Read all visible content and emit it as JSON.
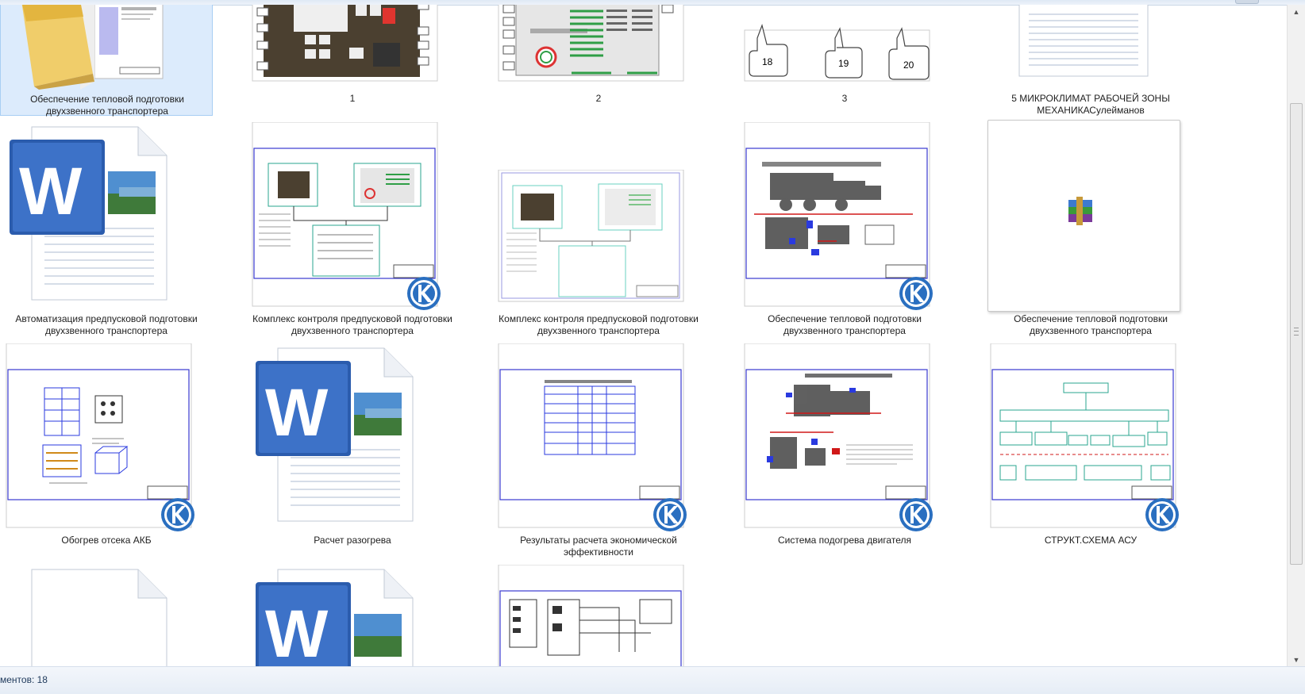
{
  "items": [
    {
      "label": "Обеспечение тепловой  подготовки двухзвенного транспортера",
      "icon": "folder-icon"
    },
    {
      "label": "1",
      "icon": "kompas-drawing-icon"
    },
    {
      "label": "2",
      "icon": "kompas-drawing-icon"
    },
    {
      "label": "3",
      "icon": "kompas-drawing-icon",
      "callouts": [
        "18",
        "19",
        "20"
      ]
    },
    {
      "label": "5 МИКРОКЛИМАТ РАБОЧЕЙ ЗОНЫ МЕХАНИКАСулейманов",
      "icon": "word-document-icon"
    },
    {
      "label": "Автоматизация предпусковой подготовки двухзвенного транспортера",
      "icon": "word-document-icon"
    },
    {
      "label": "Комплекс контроля предпусковой подготовки двухзвенного транспортера",
      "icon": "kompas-drawing-icon"
    },
    {
      "label": "Комплекс контроля предпусковой подготовки двухзвенного транспортера",
      "icon": "drawing-preview-icon"
    },
    {
      "label": "Обеспечение тепловой  подготовки двухзвенного транспортера",
      "icon": "kompas-drawing-icon"
    },
    {
      "label": "Обеспечение тепловой  подготовки двухзвенного транспортера",
      "icon": "winrar-archive-icon"
    },
    {
      "label": "Обогрев отсека АКБ",
      "icon": "kompas-drawing-icon"
    },
    {
      "label": "Расчет разогрева",
      "icon": "word-document-icon"
    },
    {
      "label": "Результаты расчета  экономической эффективности",
      "icon": "kompas-drawing-icon"
    },
    {
      "label": "Система  подогрева двигателя",
      "icon": "kompas-drawing-icon"
    },
    {
      "label": "СТРУКТ.СХЕМА АСУ",
      "icon": "kompas-drawing-icon"
    },
    {
      "label": "",
      "icon": "blank-file-icon"
    },
    {
      "label": "",
      "icon": "word-document-icon"
    },
    {
      "label": "",
      "icon": "kompas-drawing-icon"
    }
  ],
  "status": {
    "count_text": "ментов: 18"
  },
  "colors": {
    "selection": "#dcebfc",
    "kompas_blue": "#2a6fc0",
    "word_blue": "#2b5cad",
    "drawing_frame": "#3a3ad0"
  }
}
